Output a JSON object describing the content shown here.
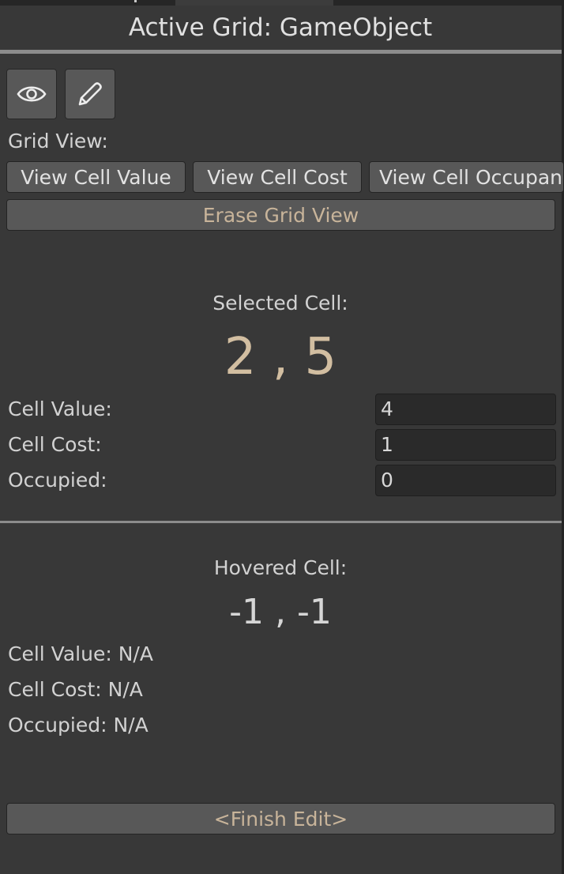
{
  "header": {
    "title": "Active Grid: GameObject"
  },
  "toolbar": {
    "view_icon": "eye-icon",
    "edit_icon": "pencil-icon"
  },
  "grid_view": {
    "label": "Grid View:",
    "buttons": [
      "View Cell Value",
      "View Cell Cost",
      "View Cell Occupancy"
    ],
    "erase_label": "Erase Grid View"
  },
  "selected": {
    "heading": "Selected Cell:",
    "coords": "2 , 5",
    "value_label": "Cell Value:",
    "value": "4",
    "cost_label": "Cell Cost:",
    "cost": "1",
    "occupied_label": "Occupied:",
    "occupied": "0"
  },
  "hovered": {
    "heading": "Hovered Cell:",
    "coords": "-1 , -1",
    "value_line": "Cell Value: N/A",
    "cost_line": "Cell Cost: N/A",
    "occupied_line": "Occupied: N/A"
  },
  "footer": {
    "finish_label": "<Finish Edit>"
  },
  "colors": {
    "accent_text": "#c8b49a",
    "background": "#383838",
    "button": "#585858"
  }
}
